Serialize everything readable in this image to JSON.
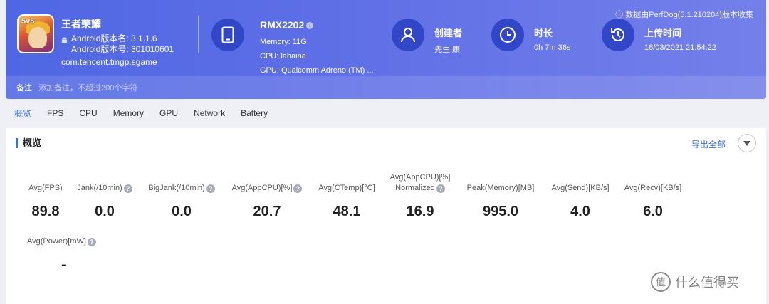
{
  "app": {
    "name": "王者荣耀",
    "icon_text": "5v5",
    "version_name": "Android版本名: 3.1.1.6",
    "version_code": "Android版本号: 301010601",
    "package": "com.tencent.tmgp.sgame"
  },
  "device": {
    "name": "RMX2202",
    "info_badge": "i",
    "memory": "Memory: 11G",
    "cpu": "CPU: lahaina",
    "gpu": "GPU: Qualcomm Adreno (TM) ..."
  },
  "creator": {
    "title": "创建者",
    "value": "先生 康"
  },
  "duration": {
    "title": "时长",
    "value": "0h 7m 36s"
  },
  "upload": {
    "title": "上传时间",
    "value": "18/03/2021 21:54:22"
  },
  "source_note": "ⓘ 数据由PerfDog(5.1.210204)版本收集",
  "note": {
    "label": "备注:",
    "placeholder": "添加备注，不超过200个字符"
  },
  "tabs": [
    "概览",
    "FPS",
    "CPU",
    "Memory",
    "GPU",
    "Network",
    "Battery"
  ],
  "panel": {
    "title": "概览",
    "export_label": "导出全部"
  },
  "metrics": [
    {
      "label": "Avg(FPS)",
      "value": "89.8",
      "help": false
    },
    {
      "label": "Jank(/10min)",
      "value": "0.0",
      "help": true
    },
    {
      "label": "BigJank(/10min)",
      "value": "0.0",
      "help": true
    },
    {
      "label": "Avg(AppCPU)[%]",
      "value": "20.7",
      "help": true
    },
    {
      "label": "Avg(CTemp)[°C]",
      "value": "48.1",
      "help": false
    },
    {
      "label": "Avg(AppCPU)[%]",
      "label2": "Normalized",
      "value": "16.9",
      "help": true
    },
    {
      "label": "Peak(Memory)[MB]",
      "value": "995.0",
      "help": false
    },
    {
      "label": "Avg(Send)[KB/s]",
      "value": "4.0",
      "help": false
    },
    {
      "label": "Avg(Recv)[KB/s]",
      "value": "6.0",
      "help": false
    },
    {
      "label": "Avg(Power)[mW]",
      "value": "-",
      "help": true
    }
  ],
  "help_glyph": "?",
  "watermark": {
    "logo": "值",
    "text": "什么值得买"
  },
  "colors": {
    "header_start": "#4f67e4",
    "header_end": "#7480ea",
    "accent": "#3a6fdc",
    "icon_circle": "#3147c8"
  }
}
